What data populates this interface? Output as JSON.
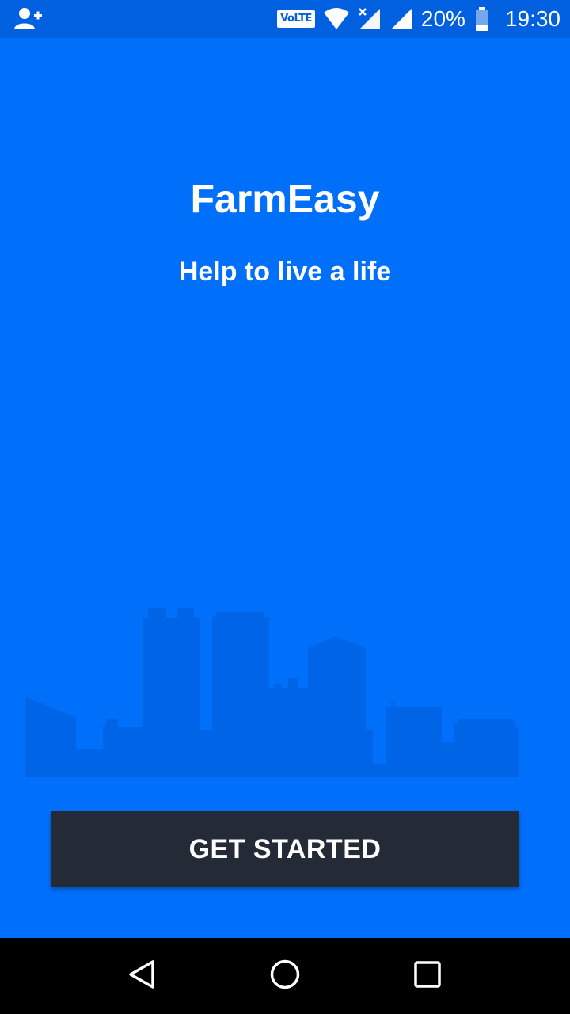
{
  "status_bar": {
    "network_badge": "VoLTE",
    "battery": "20%",
    "time": "19:30",
    "icons": [
      "add-user-icon",
      "wifi-icon",
      "no-data-signal-icon",
      "signal-icon",
      "battery-icon"
    ]
  },
  "app": {
    "title": "FarmEasy",
    "tagline": "Help to live a life",
    "get_started_label": "GET STARTED"
  },
  "navigation": {
    "icons": [
      "back-icon",
      "home-icon",
      "recents-icon"
    ]
  },
  "colors": {
    "background": "#006ffa",
    "status_bar": "#0060e0",
    "skyline": "#0064e6",
    "button": "#252a37",
    "nav_bar": "#000000"
  }
}
